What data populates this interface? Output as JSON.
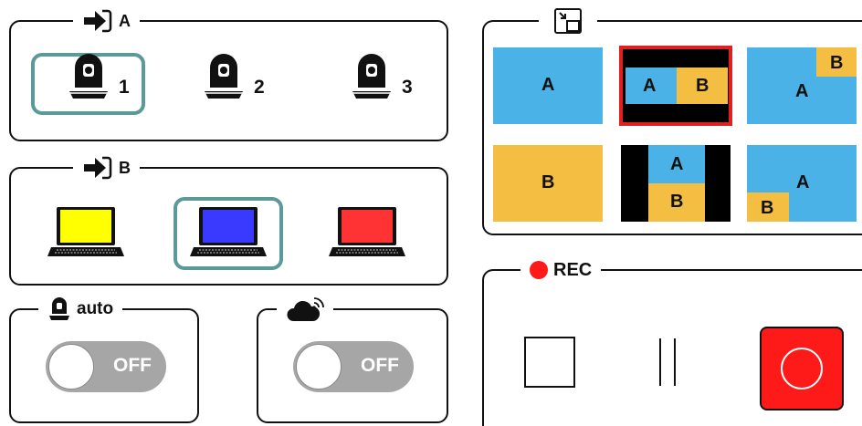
{
  "source_a": {
    "title": "A",
    "cameras": [
      {
        "number": "1",
        "selected": true
      },
      {
        "number": "2",
        "selected": false
      },
      {
        "number": "3",
        "selected": false
      }
    ]
  },
  "source_b": {
    "title": "B",
    "laptops": [
      {
        "screen_color": "#ffff00",
        "selected": false
      },
      {
        "screen_color": "#3a3aff",
        "selected": true
      },
      {
        "screen_color": "#ff3333",
        "selected": false
      }
    ]
  },
  "auto_tracking": {
    "title": "auto",
    "toggle_label": "OFF"
  },
  "streaming": {
    "toggle_label": "OFF"
  },
  "layouts": {
    "selected_index": 1,
    "tiles": [
      {
        "name": "single-a",
        "labels": [
          "A"
        ]
      },
      {
        "name": "side-by-side",
        "labels": [
          "A",
          "B"
        ]
      },
      {
        "name": "pip-top-right",
        "labels": [
          "A",
          "B"
        ]
      },
      {
        "name": "single-b",
        "labels": [
          "B"
        ]
      },
      {
        "name": "stacked",
        "labels": [
          "A",
          "B"
        ]
      },
      {
        "name": "pip-bottom-left",
        "labels": [
          "A",
          "B"
        ]
      }
    ]
  },
  "recording": {
    "title": "REC",
    "pause_glyph": "| |"
  },
  "colors": {
    "accent_selected": "#5a9a98",
    "layout_selected": "#e02020",
    "blue": "#4ab2e6",
    "orange": "#f4be42",
    "record_red": "#ff1a1a"
  }
}
